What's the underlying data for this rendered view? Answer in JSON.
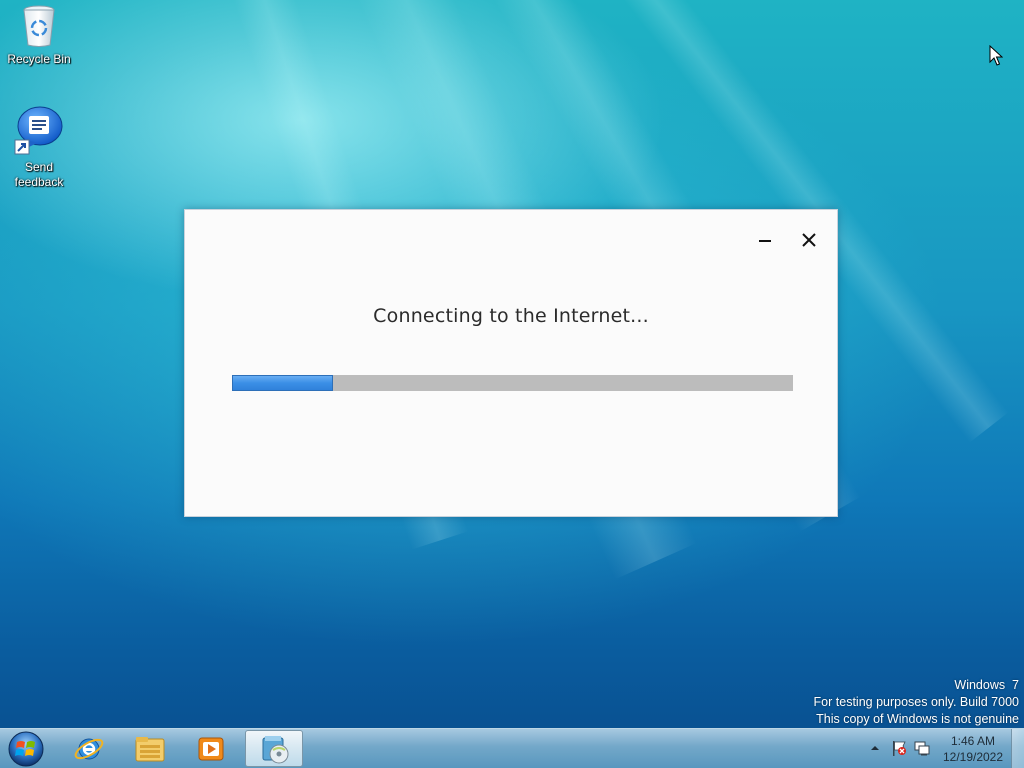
{
  "desktop": {
    "icons": [
      {
        "label": "Recycle Bin"
      },
      {
        "label": "Send\nfeedback"
      }
    ]
  },
  "dialog": {
    "message": "Connecting to the Internet...",
    "progress_percent": 18,
    "minimize_icon": "minimize-icon",
    "close_icon": "close-icon"
  },
  "watermark": {
    "line1": "Windows  7",
    "line2": "For testing purposes only. Build 7000",
    "line3": "This copy of Windows is not genuine"
  },
  "taskbar": {
    "pinned": [
      {
        "name": "internet-explorer-icon"
      },
      {
        "name": "windows-explorer-icon"
      },
      {
        "name": "media-player-icon"
      },
      {
        "name": "setup-disc-icon",
        "active": true
      }
    ],
    "clock": {
      "time": "1:46 AM",
      "date": "12/19/2022"
    }
  },
  "colors": {
    "progress_fill": "#3b8fe6",
    "progress_track": "#bcbcbc",
    "dialog_bg": "#fbfbfb"
  }
}
